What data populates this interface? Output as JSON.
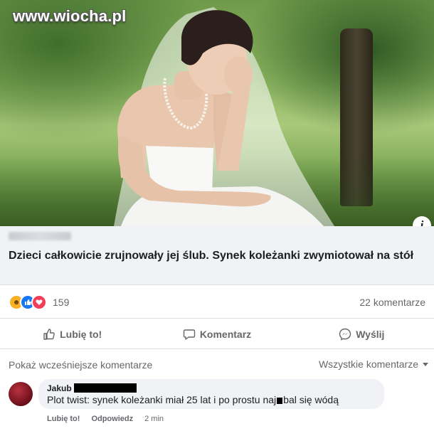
{
  "photo": {
    "watermark": "www.wiocha.pl",
    "info_icon_glyph": "i"
  },
  "post": {
    "headline": "Dzieci całkowicie zrujnowały jej ślub. Synek koleżanki zwymiotował na stół",
    "reactions": {
      "icons": [
        "haha-icon",
        "like-icon",
        "love-icon"
      ],
      "count": "159"
    },
    "comments_count": "22 komentarze",
    "actions": {
      "like": "Lubię to!",
      "comment": "Komentarz",
      "share": "Wyślij"
    }
  },
  "comments": {
    "more_label": "Pokaż wcześniejsze komentarze",
    "filter_label": "Wszystkie komentarze",
    "items": [
      {
        "author": "Jakub",
        "text_before": "Plot twist: synek koleżanki miał 25 lat i po prostu naj",
        "text_after": "bal się wódą",
        "like_label": "Lubię to!",
        "reply_label": "Odpowiedz",
        "time": "2 min"
      }
    ]
  },
  "colors": {
    "accent": "#1877f2",
    "love": "#f33e58",
    "haha": "#f7b125",
    "muted_text": "#65676b"
  }
}
